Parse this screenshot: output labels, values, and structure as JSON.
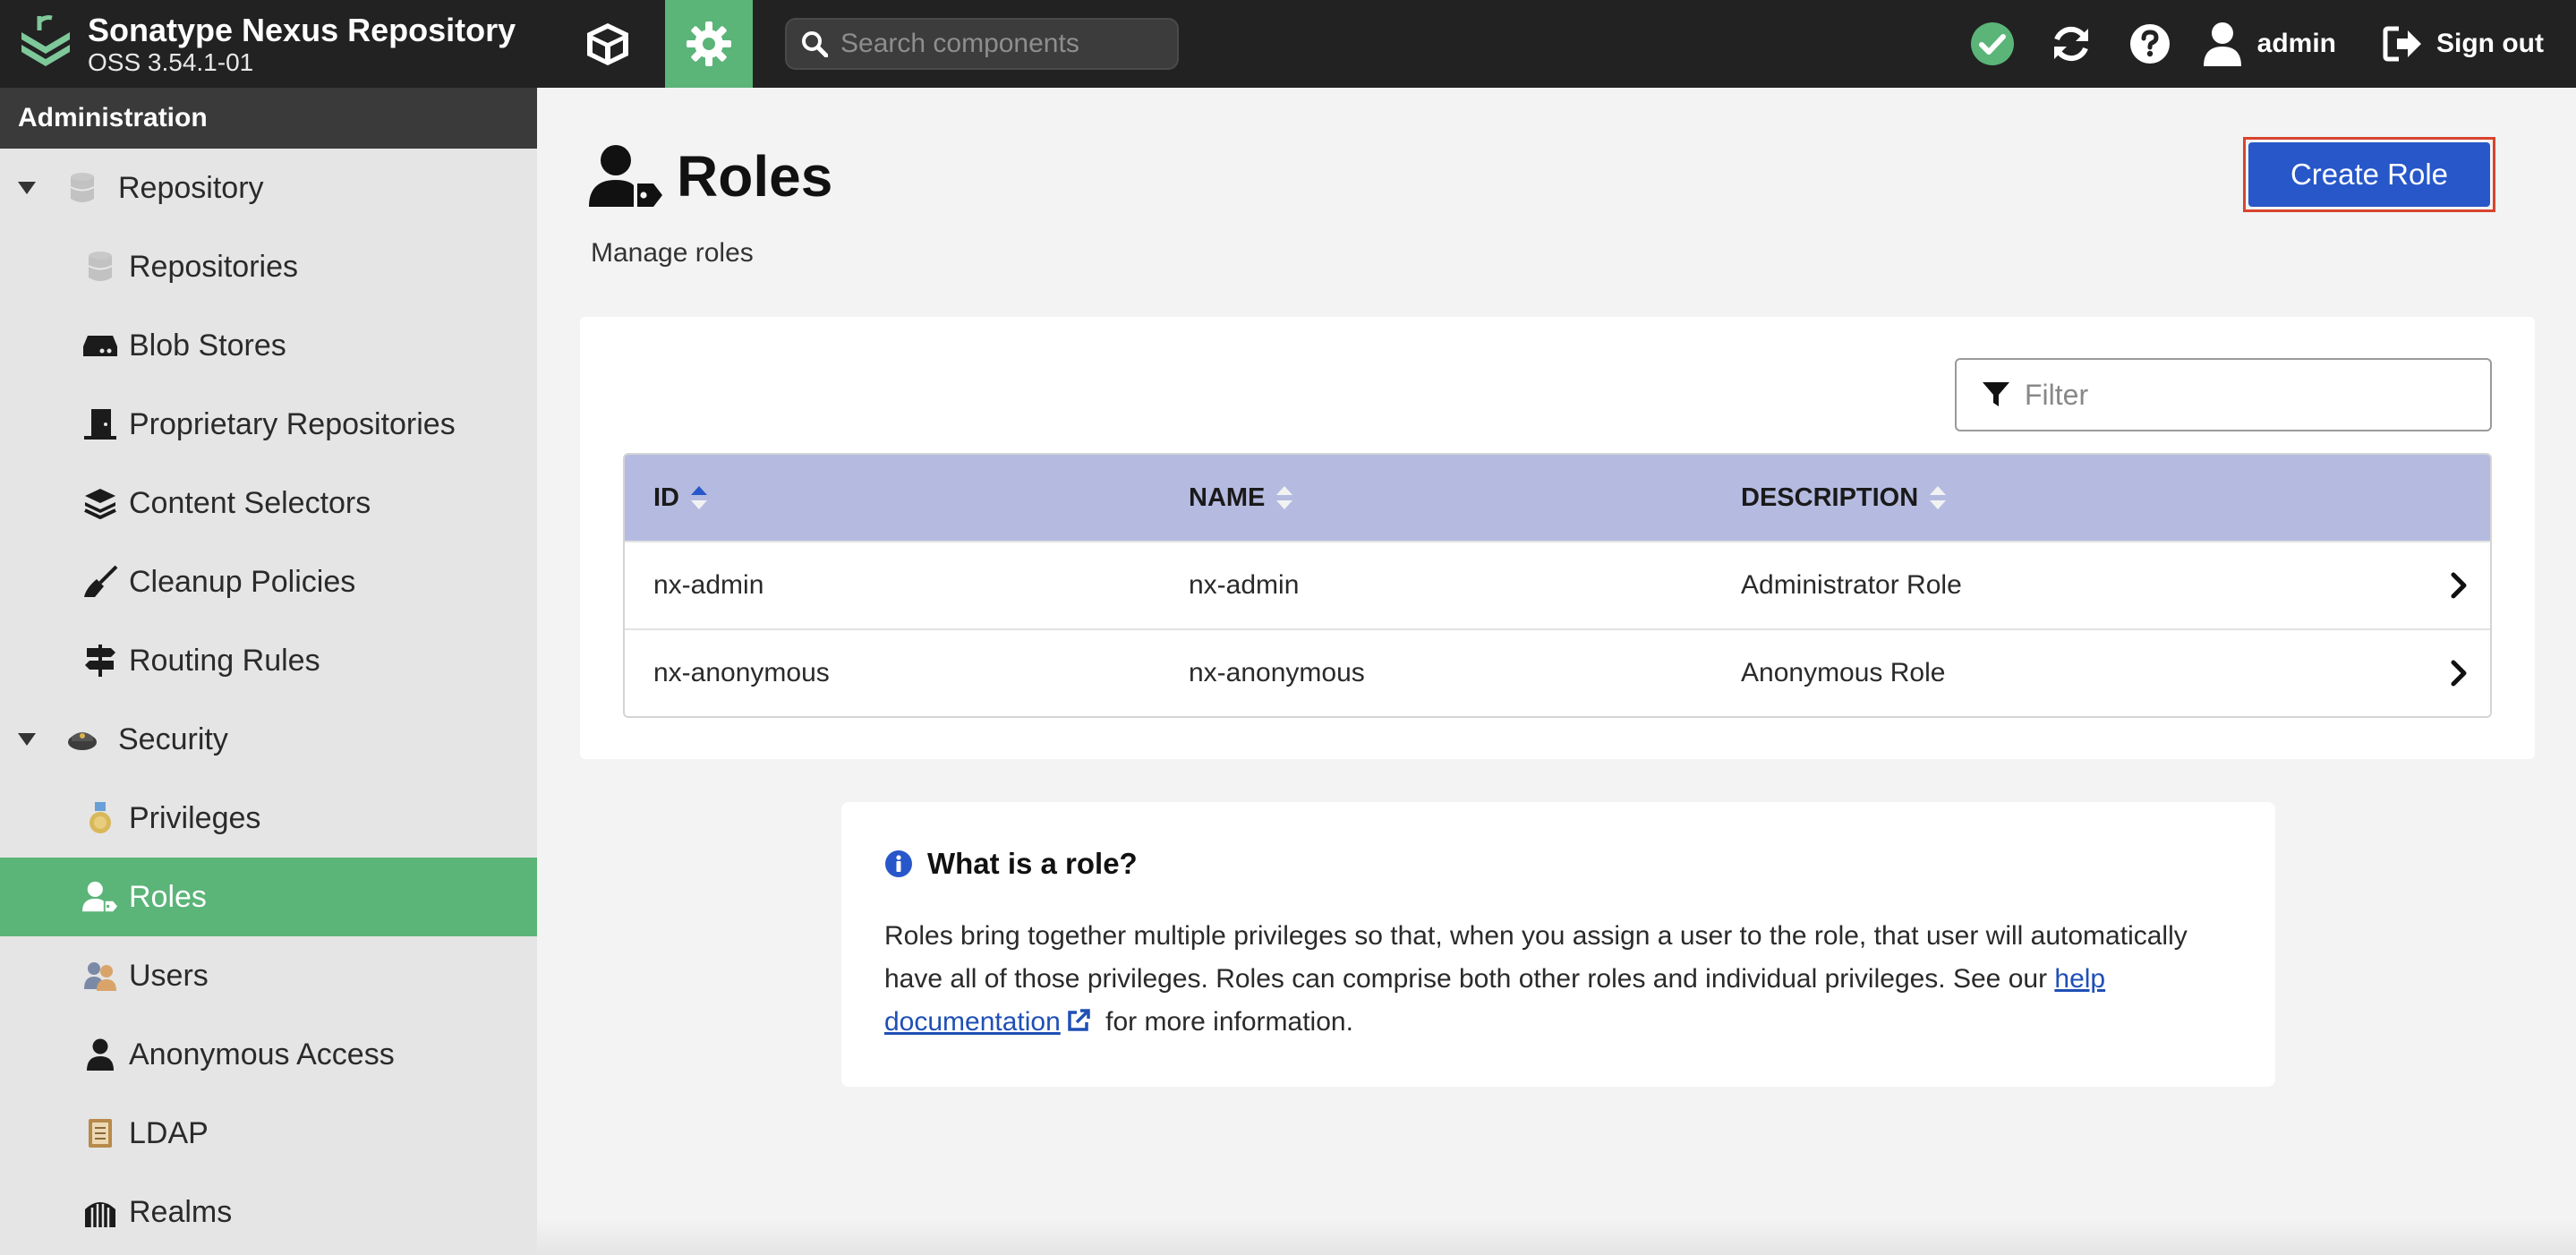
{
  "app": {
    "name": "Sonatype Nexus Repository",
    "version": "OSS 3.54.1-01"
  },
  "header": {
    "search_placeholder": "Search components",
    "user_label": "admin",
    "signout_label": "Sign out",
    "status_color": "#5bb478"
  },
  "sidebar": {
    "header": "Administration",
    "items": [
      {
        "label": "Repository",
        "kind": "group",
        "icon": "database-icon"
      },
      {
        "label": "Repositories",
        "kind": "child",
        "icon": "database-icon"
      },
      {
        "label": "Blob Stores",
        "kind": "child",
        "icon": "drive-icon"
      },
      {
        "label": "Proprietary Repositories",
        "kind": "child",
        "icon": "door-icon"
      },
      {
        "label": "Content Selectors",
        "kind": "child",
        "icon": "layers-icon"
      },
      {
        "label": "Cleanup Policies",
        "kind": "child",
        "icon": "broom-icon"
      },
      {
        "label": "Routing Rules",
        "kind": "child",
        "icon": "signpost-icon"
      },
      {
        "label": "Security",
        "kind": "group",
        "icon": "police-icon"
      },
      {
        "label": "Privileges",
        "kind": "child",
        "icon": "medal-icon"
      },
      {
        "label": "Roles",
        "kind": "child",
        "icon": "user-tag-icon",
        "active": true
      },
      {
        "label": "Users",
        "kind": "child",
        "icon": "users-icon"
      },
      {
        "label": "Anonymous Access",
        "kind": "child",
        "icon": "user-icon"
      },
      {
        "label": "LDAP",
        "kind": "child",
        "icon": "book-icon"
      },
      {
        "label": "Realms",
        "kind": "child",
        "icon": "gate-icon"
      }
    ]
  },
  "page": {
    "title": "Roles",
    "subtitle": "Manage roles",
    "create_button": "Create Role",
    "filter_placeholder": "Filter"
  },
  "table": {
    "columns": [
      "ID",
      "NAME",
      "DESCRIPTION"
    ],
    "rows": [
      {
        "id": "nx-admin",
        "name": "nx-admin",
        "description": "Administrator Role"
      },
      {
        "id": "nx-anonymous",
        "name": "nx-anonymous",
        "description": "Anonymous Role"
      }
    ]
  },
  "info": {
    "title": "What is a role?",
    "body_before": "Roles bring together multiple privileges so that, when you assign a user to the role, that user will automatically have all of those privileges. Roles can comprise both other roles and individual privileges. See our ",
    "link_text": "help documentation",
    "body_after": " for more information."
  },
  "colors": {
    "accent_green": "#5bb478",
    "primary_blue": "#2757c9",
    "table_header": "#b5bbe0",
    "highlight_red": "#d9432e"
  }
}
